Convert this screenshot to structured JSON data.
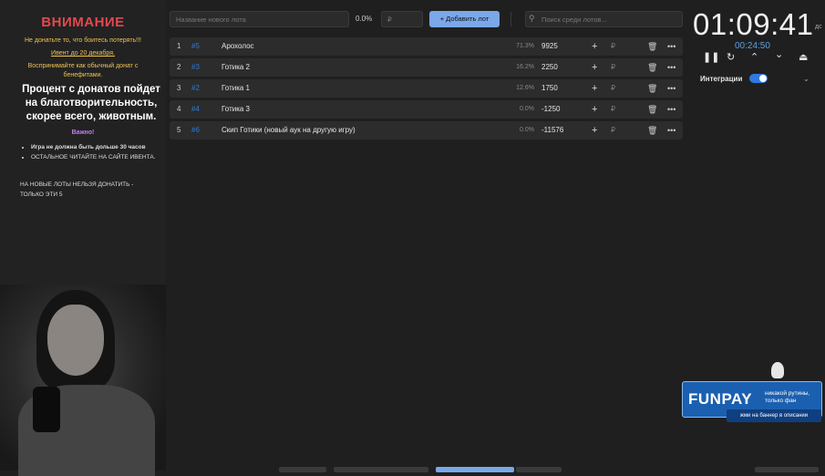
{
  "notice": {
    "title": "ВНИМАНИЕ",
    "line1": "Не донатьте то, что боитесь потерять!!!",
    "line2": "Ивент до 20 декабря.",
    "line3": "Воспринимайте как обычный донат с бенефитами.",
    "main": "Процент с донатов пойдет на благотворительность, скорее всего, животным.",
    "important": "Важно!",
    "bullets": [
      "Игра не должна быть дольше 30 часов",
      "ОСТАЛЬНОЕ ЧИТАЙТЕ НА САЙТЕ ИВЕНТА."
    ],
    "footer": "НА НОВЫЕ ЛОТЫ НЕЛЬЗЯ ДОНАТИТЬ - ТОЛЬКО ЭТИ 5"
  },
  "topbar": {
    "lot_placeholder": "Название нового лота",
    "percent": "0.0%",
    "currency_placeholder": "₽",
    "add_label": "Добавить лот",
    "search_placeholder": "Поиск среди лотов..."
  },
  "lots": [
    {
      "index": "1",
      "hash": "#5",
      "name": "Арохолос",
      "percent": "71.3%",
      "amount": "9925"
    },
    {
      "index": "2",
      "hash": "#3",
      "name": "Готика 2",
      "percent": "16.2%",
      "amount": "2250"
    },
    {
      "index": "3",
      "hash": "#2",
      "name": "Готика 1",
      "percent": "12.6%",
      "amount": "1750"
    },
    {
      "index": "4",
      "hash": "#4",
      "name": "Готика 3",
      "percent": "0.0%",
      "amount": "-1250"
    },
    {
      "index": "5",
      "hash": "#6",
      "name": "Скип Готики (новый аук на другую игру)",
      "percent": "0.0%",
      "amount": "-11576"
    }
  ],
  "timer": {
    "main": "01:09:41",
    "sub": "00:24:50",
    "side": "дс"
  },
  "integrations": {
    "label": "Интеграции",
    "enabled": true
  },
  "funpay": {
    "logo": "FUNPAY",
    "tagline": "никакой рутины, только фан",
    "cta": "жми на баннер в описании"
  },
  "colors": {
    "accent": "#7aa8e8",
    "danger": "#e5484d",
    "notice_yellow": "#f2c14e",
    "hash_blue": "#2e7bd6"
  }
}
